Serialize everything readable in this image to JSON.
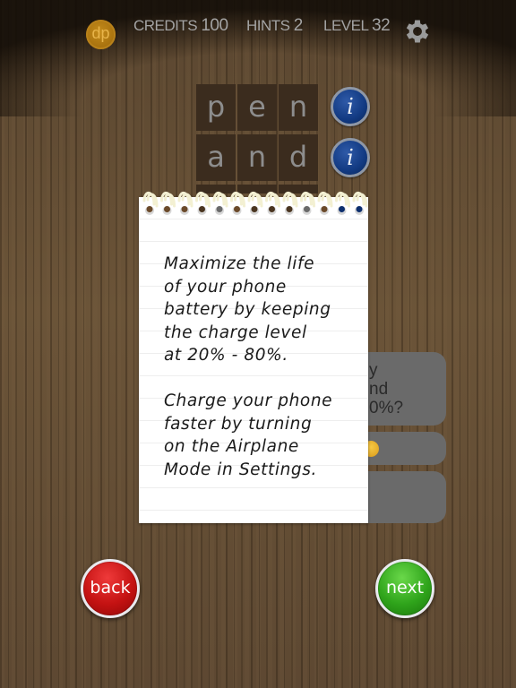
{
  "header": {
    "coin_label": "dp",
    "credits_label": "CREDITS",
    "credits_value": "100",
    "hints_label": "HINTS",
    "hints_value": "2",
    "level_label": "LEVEL",
    "level_value": "32",
    "settings_icon": "gear-icon"
  },
  "puzzle": {
    "rows": [
      {
        "letters": [
          "p",
          "e",
          "n"
        ],
        "info_icon": "info-icon"
      },
      {
        "letters": [
          "a",
          "n",
          "d"
        ],
        "info_icon": "info-icon"
      }
    ]
  },
  "hidden_bubbles": [
    {
      "text": "y\nnd\n0%?"
    },
    {
      "text": "",
      "icon": "smiley-icon"
    },
    {
      "text": ""
    }
  ],
  "notepad": {
    "paragraph_1": "Maximize the life\nof your phone\nbattery by keeping\nthe charge level\nat 20% - 80%.",
    "paragraph_2": "Charge your phone\nfaster by turning\non the Airplane\nMode in Settings."
  },
  "buttons": {
    "back_label": "back",
    "next_label": "next"
  },
  "colors": {
    "back_button": "#c41212",
    "next_button": "#2fa41b",
    "info_button": "#123a82",
    "coin": "#a8720f"
  }
}
